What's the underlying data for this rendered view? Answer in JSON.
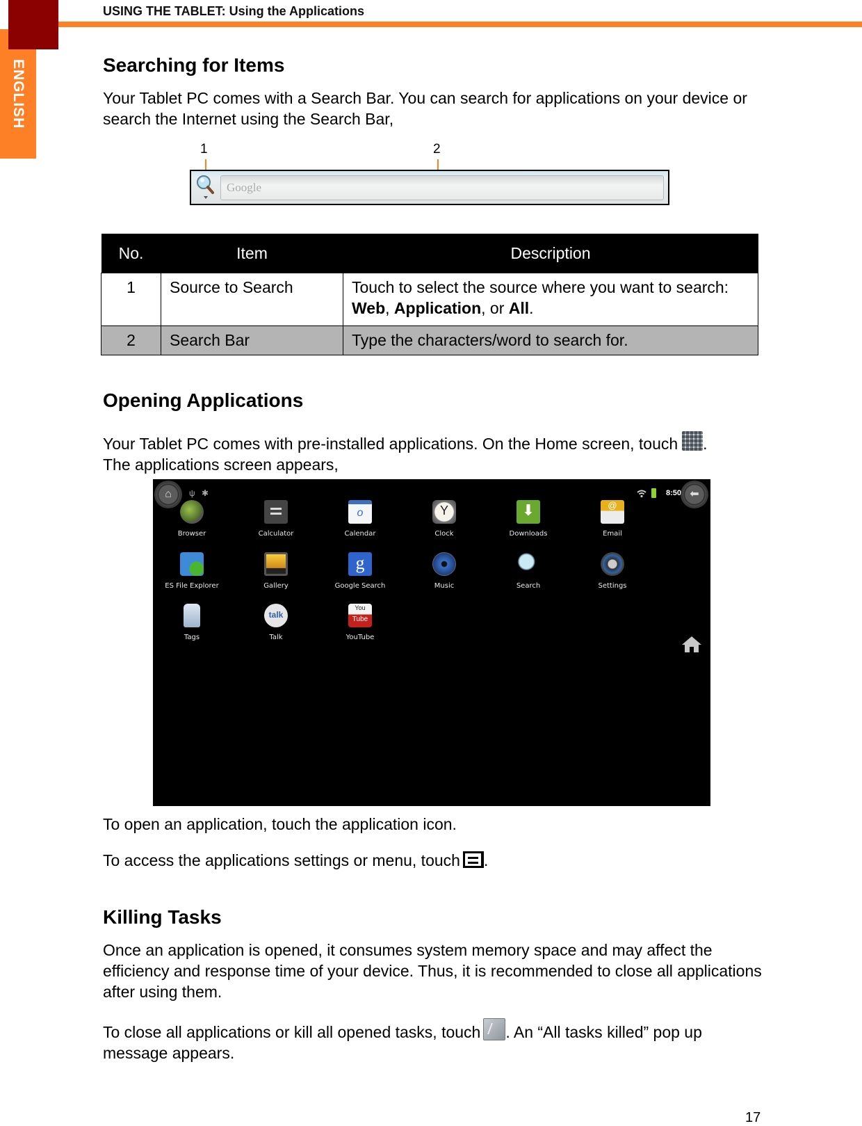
{
  "header": {
    "language_tab": "ENGLISH",
    "title": "USING THE TABLET: Using the Applications"
  },
  "sections": {
    "searching": {
      "heading": "Searching for Items",
      "intro": "Your Tablet PC comes with a Search Bar. You can search for applications on your device or search the Internet using the Search Bar,",
      "figure": {
        "callout_1": "1",
        "callout_2": "2",
        "search_placeholder": "Google",
        "icons": [
          "search-source-icon",
          "chevron-down-icon"
        ]
      },
      "table": {
        "headers": [
          "No.",
          "Item",
          "Description"
        ],
        "rows": [
          {
            "no": "1",
            "item": "Source to Search",
            "description_prefix": "Touch to select the source where you want to search: ",
            "options": [
              "Web",
              "Application",
              "All"
            ],
            "sep1": ", ",
            "sep2": ", or ",
            "suffix": "."
          },
          {
            "no": "2",
            "item": "Search Bar",
            "description": "Type the characters/word to search for."
          }
        ]
      }
    },
    "opening": {
      "heading": "Opening Applications",
      "intro_before_icon": "Your Tablet PC comes with pre-installed applications. On the Home screen, touch",
      "intro_after_icon": ".",
      "intro_line2": "The applications screen appears,",
      "inline_icon": "app-grid-icon",
      "screen": {
        "status_time": "8:50",
        "status_icons": [
          "home-icon",
          "usb-icon",
          "android-debug-icon",
          "wifi-icon",
          "battery-icon",
          "back-icon"
        ],
        "apps": [
          {
            "label": "Browser",
            "icon": "globe-icon"
          },
          {
            "label": "Calculator",
            "icon": "calculator-icon"
          },
          {
            "label": "Calendar",
            "icon": "calendar-icon"
          },
          {
            "label": "Clock",
            "icon": "clock-icon"
          },
          {
            "label": "Downloads",
            "icon": "download-icon"
          },
          {
            "label": "Email",
            "icon": "email-icon"
          },
          {
            "label": "ES File Explorer",
            "icon": "folder-icon"
          },
          {
            "label": "Gallery",
            "icon": "gallery-icon"
          },
          {
            "label": "Google Search",
            "icon": "google-icon"
          },
          {
            "label": "Music",
            "icon": "speaker-icon"
          },
          {
            "label": "Search",
            "icon": "magnifier-icon"
          },
          {
            "label": "Settings",
            "icon": "settings-icon"
          },
          {
            "label": "Tags",
            "icon": "nfc-tag-icon"
          },
          {
            "label": "Talk",
            "icon": "talk-bubble-icon"
          },
          {
            "label": "YouTube",
            "icon": "youtube-icon"
          }
        ]
      },
      "open_text": "To open an application, touch the application icon.",
      "menu_text_before": "To access the applications settings or menu, touch",
      "menu_text_after": ".",
      "menu_icon": "menu-icon"
    },
    "killing": {
      "heading": "Killing Tasks",
      "body": "Once an application is opened, it consumes system memory space and may affect the efficiency and response time of your device. Thus, it is recommended to close all applications after using them.",
      "close_before": "To close all applications or kill all opened tasks, touch",
      "close_after": ". An “All tasks killed” pop up message appears.",
      "kill_icon": "task-killer-icon"
    }
  },
  "colors": {
    "accent_orange": "#fd8026",
    "dark_red": "#8b0000",
    "table_header_bg": "#000000",
    "table_shade": "#b4b4b4"
  },
  "footer": {
    "page_number": "17"
  }
}
